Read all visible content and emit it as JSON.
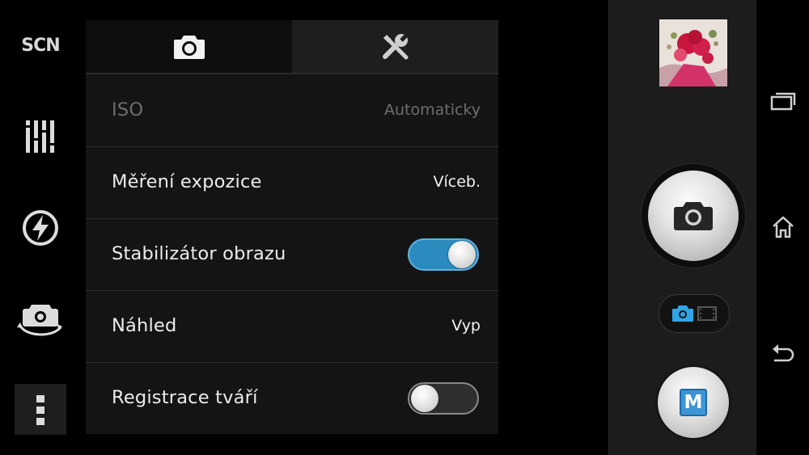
{
  "left_toolbar": {
    "scene_label": "SCN",
    "icons": [
      "scene-mode",
      "settings-sliders-icon",
      "flash-auto-icon",
      "switch-camera-icon",
      "more-options-icon"
    ]
  },
  "tabs": [
    {
      "name": "camera-settings",
      "icon": "camera-icon",
      "active": true
    },
    {
      "name": "general-settings",
      "icon": "tools-icon",
      "active": false
    }
  ],
  "settings": {
    "iso": {
      "label": "ISO",
      "value": "Automaticky",
      "enabled": false
    },
    "metering": {
      "label": "Měření expozice",
      "value": "Víceb."
    },
    "stabilizer": {
      "label": "Stabilizátor obrazu",
      "on": true
    },
    "preview": {
      "label": "Náhled",
      "value": "Vyp"
    },
    "face_registration": {
      "label": "Registrace tváří",
      "on": false
    }
  },
  "right_controls": {
    "mode_button_label": "M",
    "capture_mode": "photo"
  },
  "navigation": [
    "recent-apps",
    "home",
    "back"
  ],
  "colors": {
    "accent": "#2b8bbf",
    "panel_bg": "#141414",
    "controls_bg": "#1c1c1c",
    "mode_badge": "#3d95d6"
  }
}
